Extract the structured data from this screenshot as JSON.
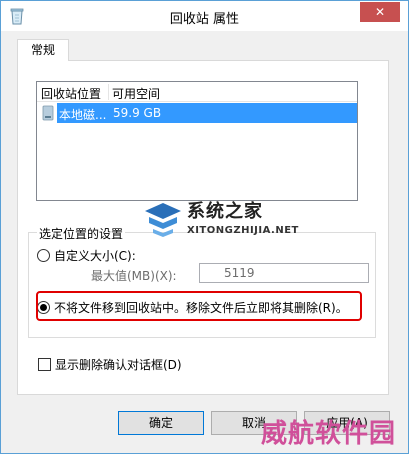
{
  "window": {
    "title": "回收站 属性",
    "close_glyph": "✕",
    "title_icon": "recycle-bin-icon"
  },
  "tabs": [
    {
      "label": "常规"
    }
  ],
  "listview": {
    "columns": [
      "回收站位置",
      "可用空间"
    ],
    "rows": [
      {
        "location": "本地磁...",
        "free_space": "59.9 GB",
        "icon": "drive-icon",
        "selected": true
      }
    ]
  },
  "settings": {
    "group_label": "选定位置的设置",
    "custom_size_label": "自定义大小(C):",
    "max_size_label": "最大值(MB)(X):",
    "max_size_value": "5119",
    "no_move_label": "不将文件移到回收站中。移除文件后立即将其删除(R)。",
    "selected_option": "no_move"
  },
  "confirm_dialog_label": "显示删除确认对话框(D)",
  "buttons": {
    "ok": "确定",
    "cancel": "取消",
    "apply": "应用(A)"
  },
  "watermarks": {
    "site_title": "系统之家",
    "site_url": "XITONGZHIJIA.NET",
    "site_logo": "xitongzhijia-logo",
    "corner": "威航软件园"
  },
  "colors": {
    "accent": "#3399ff",
    "close": "#c75050",
    "highlight": "#e00000",
    "window_border": "#5aa0d6"
  }
}
